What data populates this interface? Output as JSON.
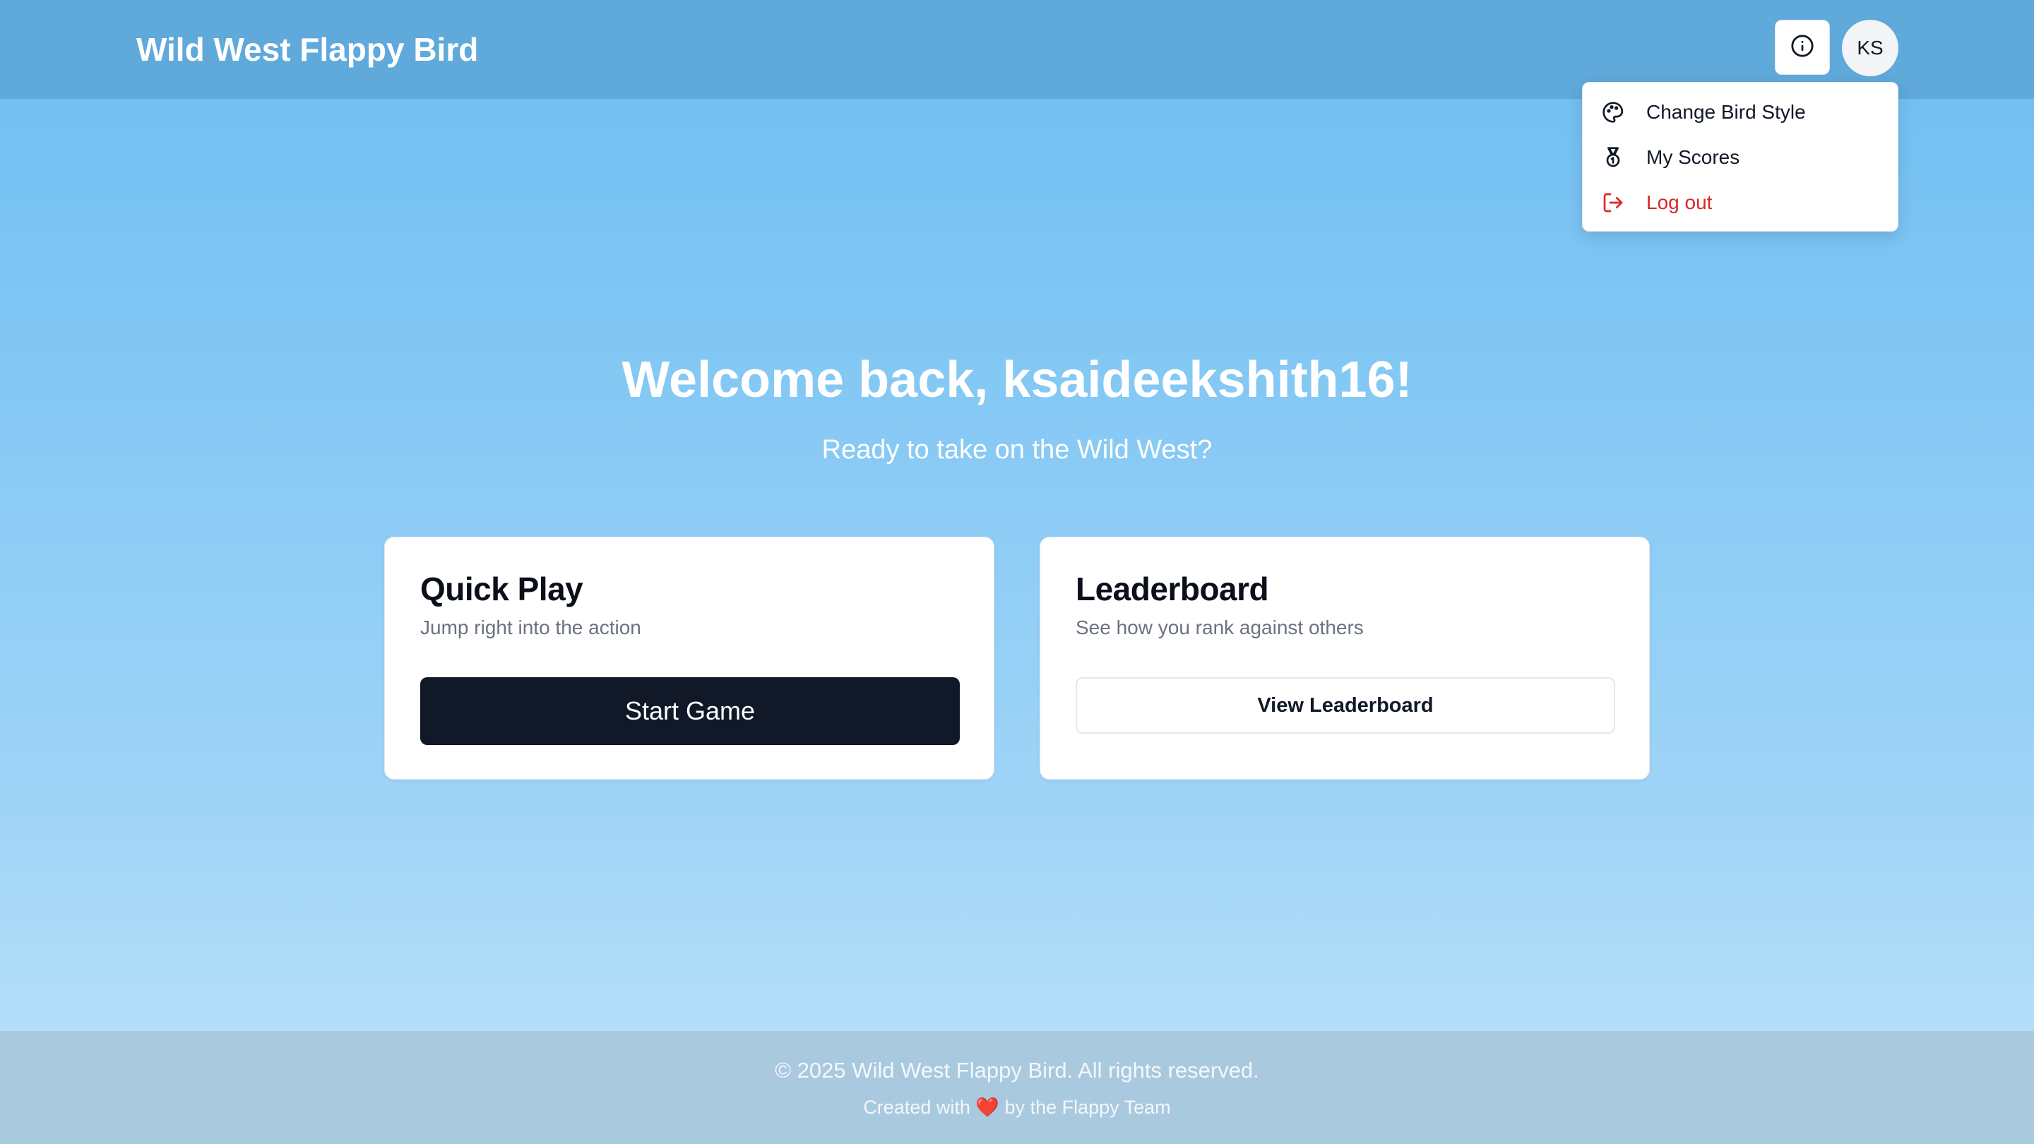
{
  "header": {
    "title": "Wild West Flappy Bird",
    "info_icon": "info-icon",
    "avatar_initials": "KS"
  },
  "user_menu": {
    "items": [
      {
        "label": "Change Bird Style",
        "icon": "palette-icon"
      },
      {
        "label": "My Scores",
        "icon": "medal-icon"
      },
      {
        "label": "Log out",
        "icon": "logout-icon",
        "color": "#dc2626"
      }
    ]
  },
  "main": {
    "welcome": "Welcome back, ksaideekshith16!",
    "subtitle": "Ready to take on the Wild West?",
    "cards": [
      {
        "title": "Quick Play",
        "description": "Jump right into the action",
        "button": "Start Game"
      },
      {
        "title": "Leaderboard",
        "description": "See how you rank against others",
        "button": "View Leaderboard"
      }
    ]
  },
  "footer": {
    "copyright": "© 2025 Wild West Flappy Bird. All rights reserved.",
    "credit_before": "Created with",
    "credit_heart": "❤️",
    "credit_after": "by the Flappy Team"
  },
  "colors": {
    "header_bg": "#5fa9db",
    "primary_button": "#111827",
    "danger": "#dc2626"
  }
}
